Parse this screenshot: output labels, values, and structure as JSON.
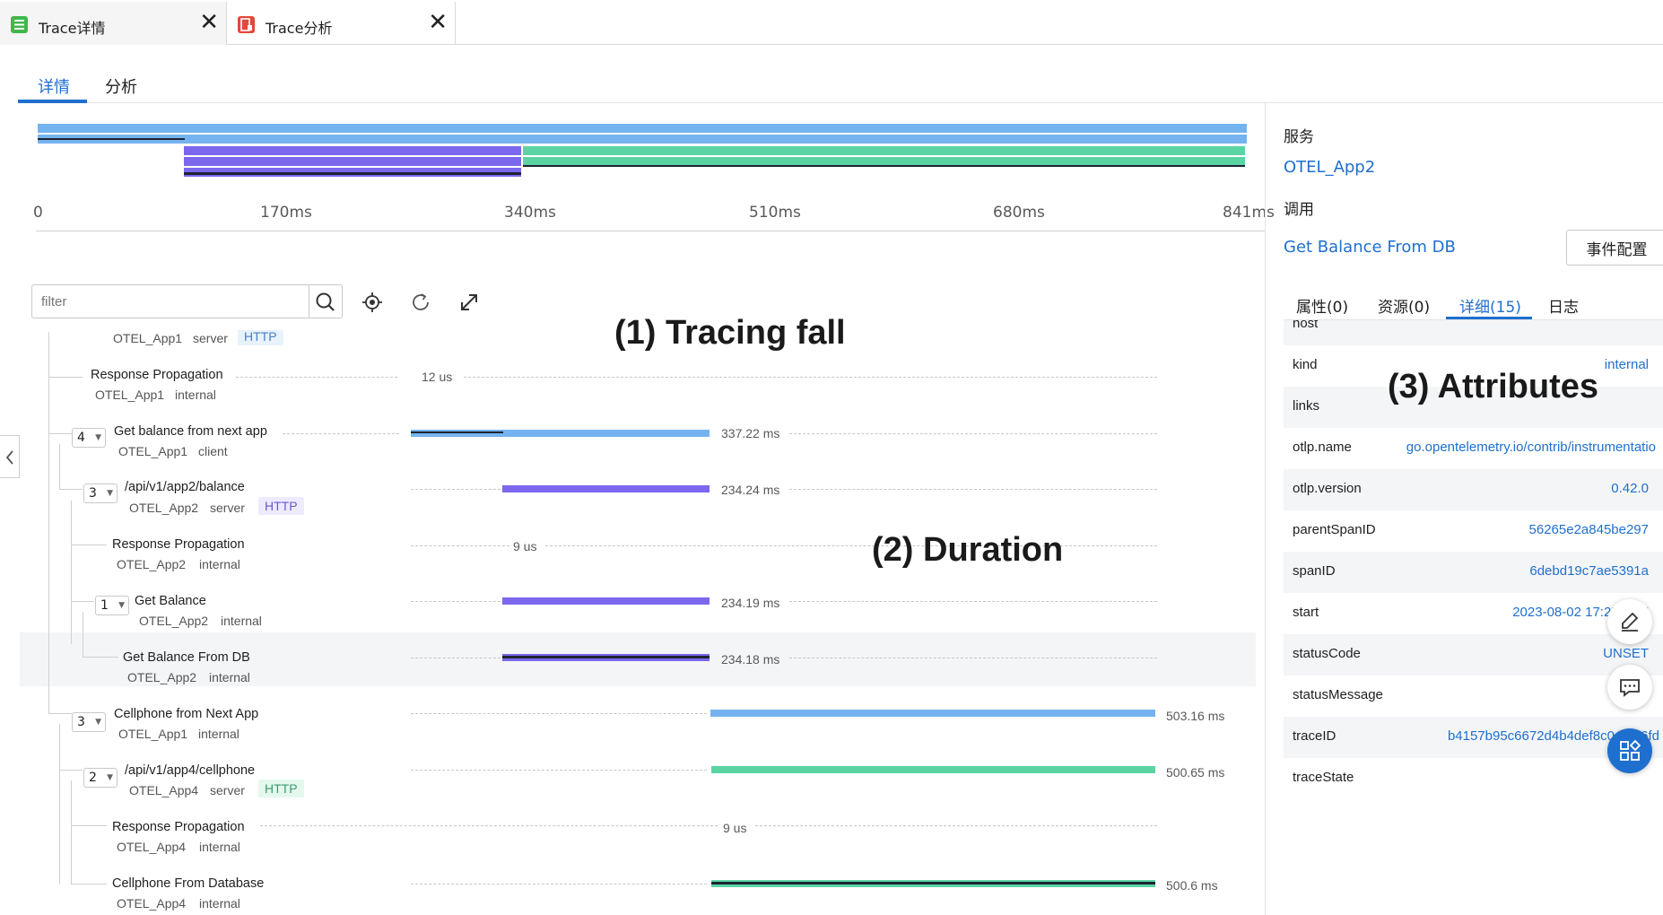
{
  "window_tabs": [
    {
      "label": "Trace详情",
      "icon": "table-icon",
      "close": "✕"
    },
    {
      "label": "Trace分析",
      "icon": "report-icon",
      "close": "✕"
    }
  ],
  "sub_tabs": [
    "详情",
    "分析"
  ],
  "overview_axis": [
    "0",
    "170ms",
    "340ms",
    "510ms",
    "680ms",
    "841ms"
  ],
  "filter": {
    "placeholder": "filter",
    "value": ""
  },
  "annotations": {
    "tracing_fall": "(1) Tracing fall",
    "duration": "(2) Duration",
    "attributes": "(3) Attributes"
  },
  "spans": [
    {
      "name": "",
      "service": "OTEL_App1",
      "kind": "server",
      "tag": "HTTP",
      "count": "",
      "duration": "",
      "progress_start": 0.0,
      "progress_end": 0.0
    },
    {
      "name": "Response Propagation",
      "service": "OTEL_App1",
      "kind": "internal",
      "tag": "",
      "count": "",
      "duration": "12 us",
      "progress_start": 0.0,
      "progress_end": 0.0
    },
    {
      "name": "Get balance from next app",
      "service": "OTEL_App1",
      "kind": "client",
      "tag": "",
      "count": "4",
      "duration": "337.22 ms",
      "progress_start": 0.0,
      "progress_end": 0.4
    },
    {
      "name": "/api/v1/app2/balance",
      "service": "OTEL_App2",
      "kind": "server",
      "tag": "HTTP",
      "count": "3",
      "duration": "234.24 ms",
      "progress_start": 0.12,
      "progress_end": 0.4
    },
    {
      "name": "Response Propagation",
      "service": "OTEL_App2",
      "kind": "internal",
      "tag": "",
      "count": "",
      "duration": "9 us",
      "progress_start": 0.12,
      "progress_end": 0.12
    },
    {
      "name": "Get Balance",
      "service": "OTEL_App2",
      "kind": "internal",
      "tag": "",
      "count": "1",
      "duration": "234.19 ms",
      "progress_start": 0.12,
      "progress_end": 0.4
    },
    {
      "name": "Get Balance From DB",
      "service": "OTEL_App2",
      "kind": "internal",
      "tag": "",
      "count": "",
      "duration": "234.18 ms",
      "progress_start": 0.12,
      "progress_end": 0.4
    },
    {
      "name": "Cellphone from Next App",
      "service": "OTEL_App1",
      "kind": "internal",
      "tag": "",
      "count": "3",
      "duration": "503.16 ms",
      "progress_start": 0.4,
      "progress_end": 1.0
    },
    {
      "name": "/api/v1/app4/cellphone",
      "service": "OTEL_App4",
      "kind": "server",
      "tag": "HTTP",
      "count": "2",
      "duration": "500.65 ms",
      "progress_start": 0.4,
      "progress_end": 1.0
    },
    {
      "name": "Response Propagation",
      "service": "OTEL_App4",
      "kind": "internal",
      "tag": "",
      "count": "",
      "duration": "9 us",
      "progress_start": 0.4,
      "progress_end": 0.4
    },
    {
      "name": "Cellphone From Database",
      "service": "OTEL_App4",
      "kind": "internal",
      "tag": "",
      "count": "",
      "duration": "500.6 ms",
      "progress_start": 0.4,
      "progress_end": 1.0
    }
  ],
  "detail": {
    "service_label": "服务",
    "service_value": "OTEL_App2",
    "call_label": "调用",
    "call_value": "Get Balance From DB",
    "event_config": "事件配置",
    "tabs": [
      "属性(0)",
      "资源(0)",
      "详细(15)",
      "日志"
    ],
    "attributes": [
      {
        "key": "host",
        "value": ""
      },
      {
        "key": "kind",
        "value": "internal"
      },
      {
        "key": "links",
        "value": ""
      },
      {
        "key": "otlp.name",
        "value": "go.opentelemetry.io/contrib/instrumentatio"
      },
      {
        "key": "otlp.version",
        "value": "0.42.0"
      },
      {
        "key": "parentSpanID",
        "value": "56265e2a845be297"
      },
      {
        "key": "spanID",
        "value": "6debd19c7ae5391a"
      },
      {
        "key": "start",
        "value": "2023-08-02 17:27:26.7"
      },
      {
        "key": "statusCode",
        "value": "UNSET"
      },
      {
        "key": "statusMessage",
        "value": ""
      },
      {
        "key": "traceID",
        "value": "b4157b95c6672d4b4def8c043f96fd"
      },
      {
        "key": "traceState",
        "value": ""
      }
    ]
  },
  "colors": {
    "accent": "#1f6fcf",
    "blue": "#74b3ef",
    "purple": "#7b68ee",
    "green": "#5bd4a3",
    "dark": "#1d2433"
  }
}
